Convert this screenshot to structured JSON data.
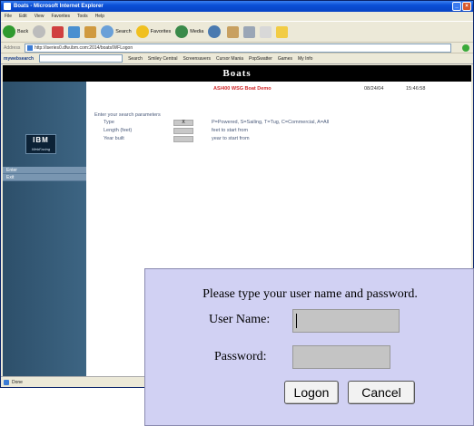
{
  "window": {
    "title": "Boats - Microsoft Internet Explorer",
    "status": "Done"
  },
  "menu": [
    "File",
    "Edit",
    "View",
    "Favorites",
    "Tools",
    "Help"
  ],
  "toolbar": {
    "back_label": "Back",
    "search_label": "Search",
    "favorites_label": "Favorites",
    "media_label": "Media"
  },
  "address": {
    "label": "Address",
    "url": "http://iseries0.dfw.ibm.com:2014/boats/WFLogon",
    "links_label": "Links"
  },
  "linksbar": {
    "brand": "mywebsearch",
    "search_label": "Search",
    "items": [
      "Smiley Central",
      "Screensavers",
      "Cursor Mania",
      "PopSwatter",
      "Games",
      "My Info"
    ]
  },
  "page": {
    "header": "Boats",
    "demo_title": "AS/400 WSG Boat Demo",
    "date": "08/24/04",
    "time": "15:46:58",
    "logo_main": "IBM",
    "logo_sub": "WebFacing",
    "nav": [
      "Enter",
      "Exit"
    ],
    "form_title": "Enter your search parameters",
    "fields": [
      {
        "label": "Type",
        "value": "X",
        "hint": "P=Powered, S=Sailing, T=Tug, C=Commercial, A=All"
      },
      {
        "label": "Length (feet)",
        "value": "",
        "hint": "feet to start from"
      },
      {
        "label": "Year built",
        "value": "",
        "hint": "year to start from"
      }
    ]
  },
  "dialog": {
    "message": "Please type your user name and password.",
    "username_label": "User Name:",
    "password_label": "Password:",
    "logon_button": "Logon",
    "cancel_button": "Cancel"
  }
}
